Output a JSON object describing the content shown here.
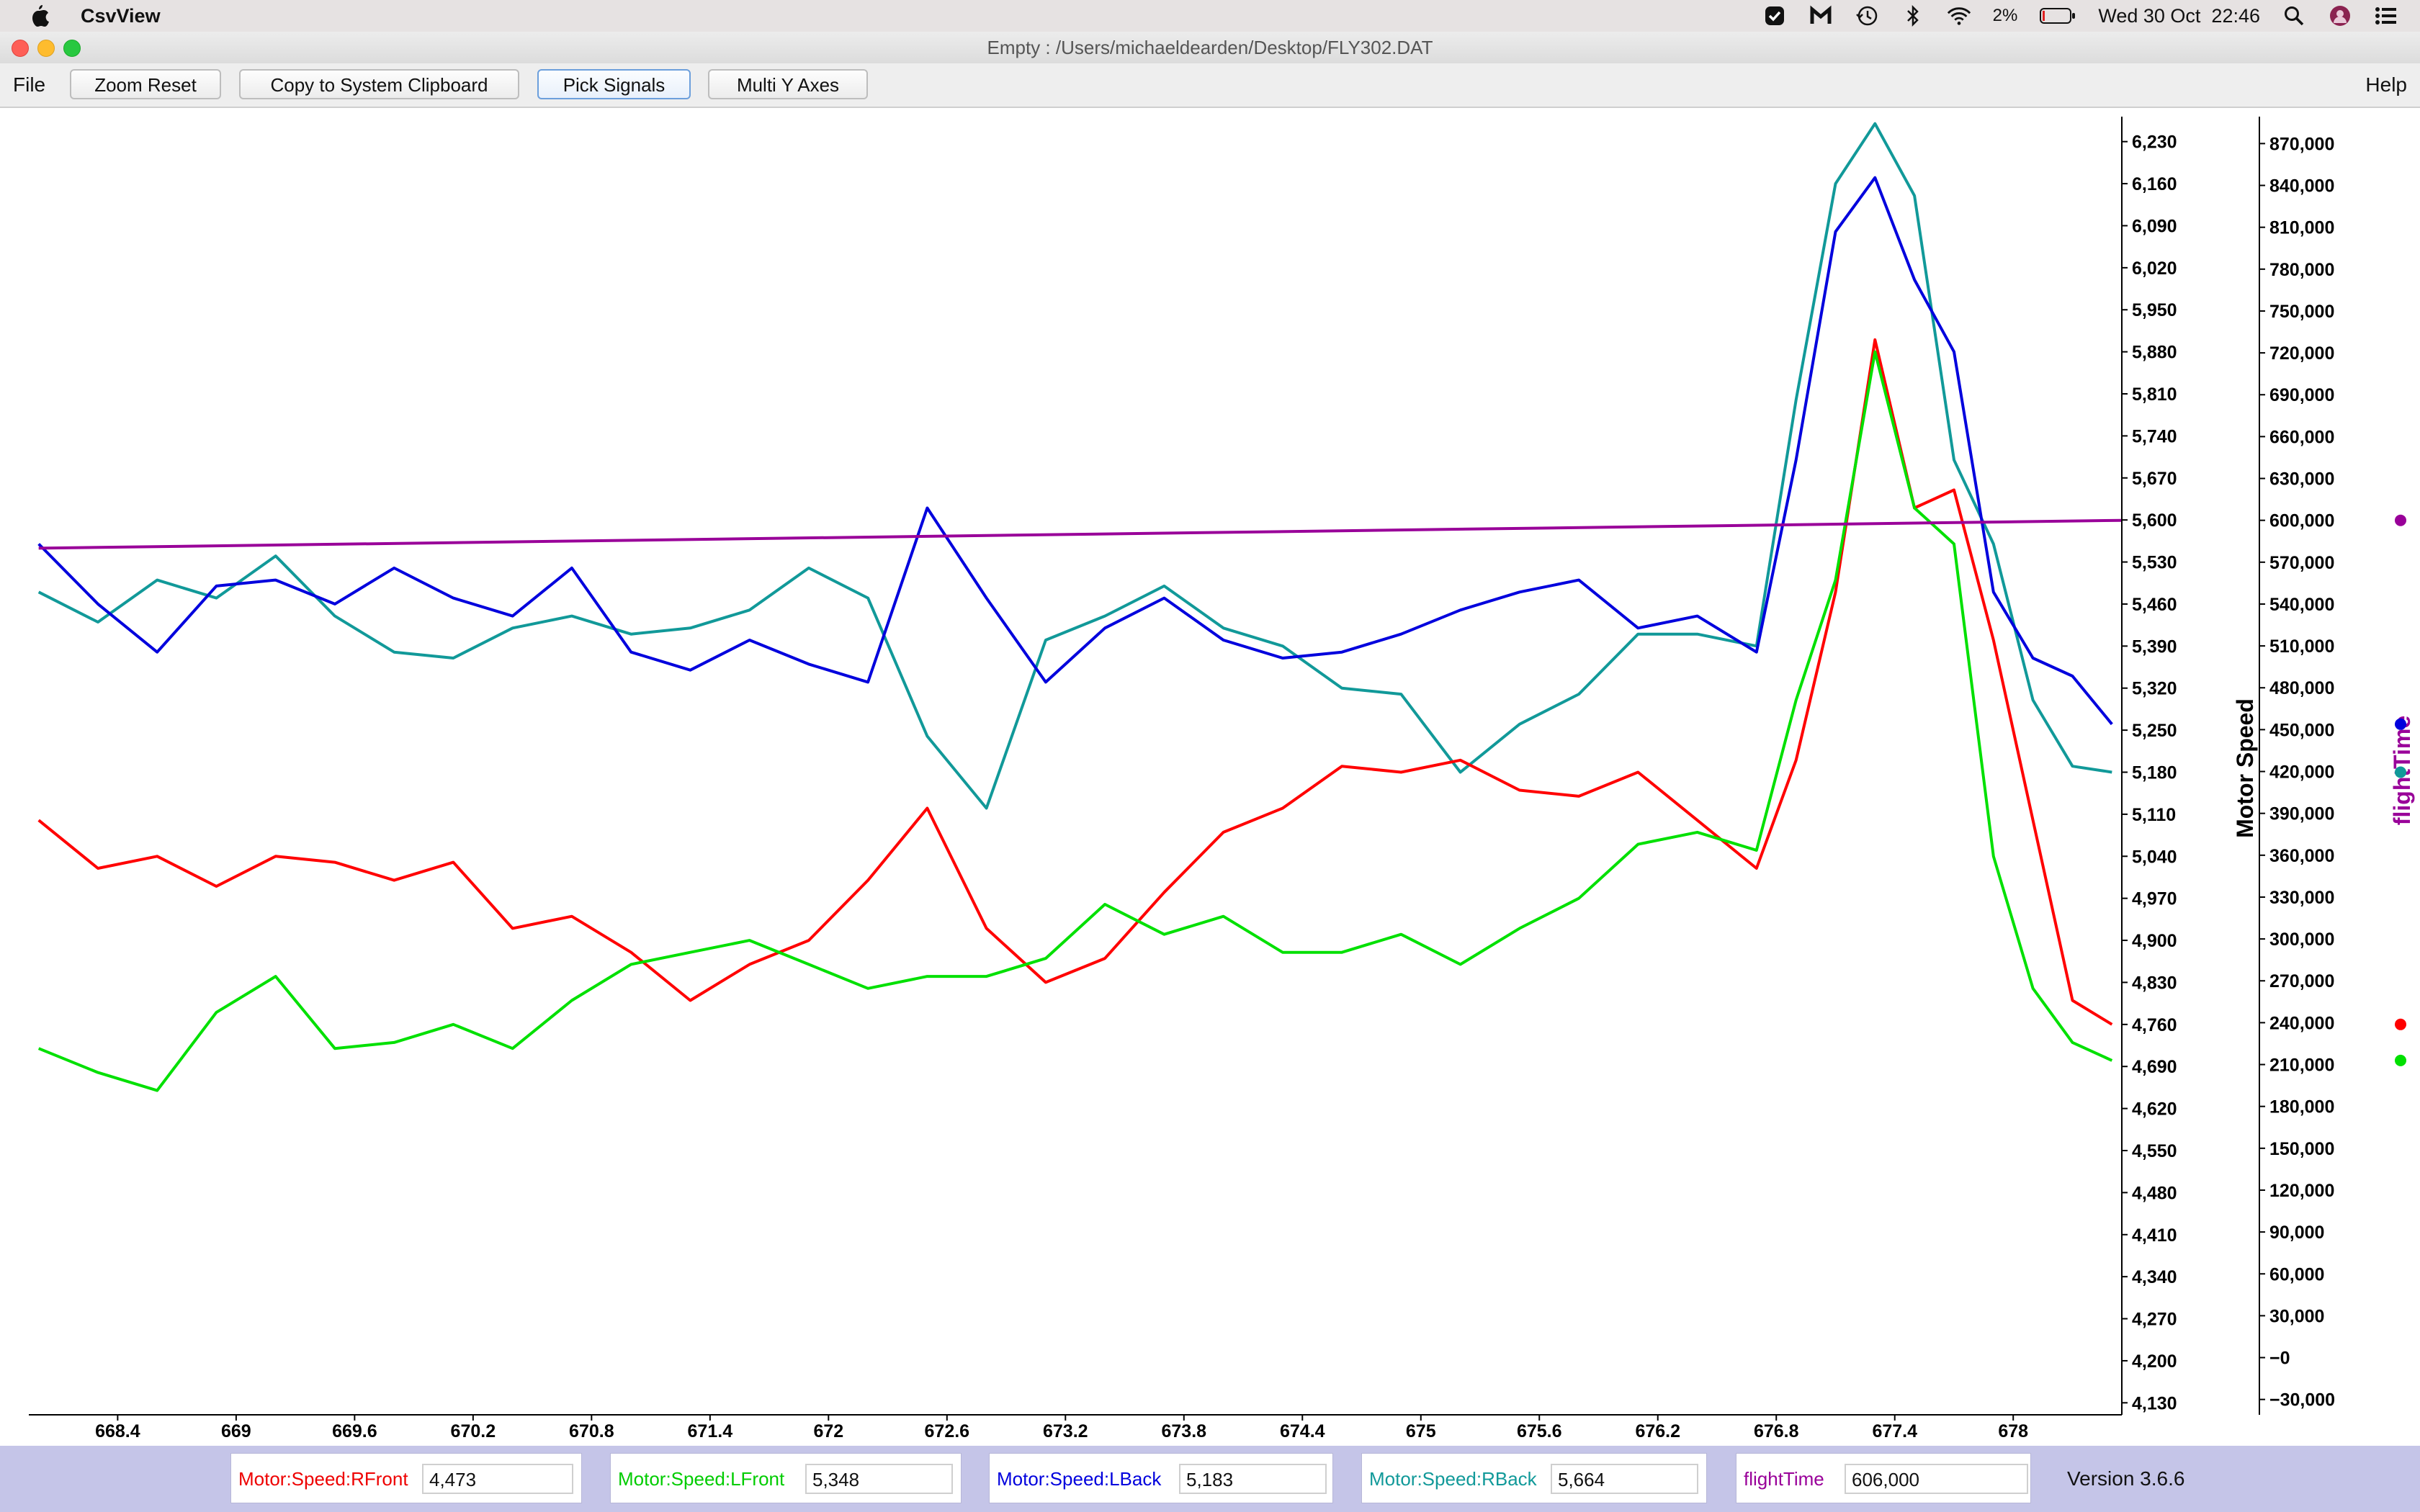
{
  "menubar": {
    "app_name": "CsvView",
    "battery": "2%",
    "clock": "Wed 30 Oct  22:46"
  },
  "window": {
    "title": "Empty : /Users/michaeldearden/Desktop/FLY302.DAT"
  },
  "toolbar": {
    "file_label": "File",
    "help_label": "Help",
    "buttons": [
      {
        "label": "Zoom Reset"
      },
      {
        "label": "Copy to System Clipboard"
      },
      {
        "label": "Pick Signals"
      },
      {
        "label": "Multi Y Axes"
      }
    ]
  },
  "colors": {
    "rfront": "#ff0000",
    "lfront": "#00e000",
    "lback": "#0000dd",
    "rback": "#119999",
    "flighttime": "#990099",
    "statusbar": "#c5c5e8"
  },
  "chart_data": {
    "type": "line",
    "xlim": [
      667.95,
      678.55
    ],
    "x_ticks": [
      "668.4",
      "669",
      "669.6",
      "670.2",
      "670.8",
      "671.4",
      "672",
      "672.6",
      "673.2",
      "673.8",
      "674.4",
      "675",
      "675.6",
      "676.2",
      "676.8",
      "677.4",
      "678"
    ],
    "y1": {
      "label": "Motor Speed",
      "ylim": [
        4110,
        6250
      ],
      "ticks": [
        "6,230",
        "6,160",
        "6,090",
        "6,020",
        "5,950",
        "5,880",
        "5,810",
        "5,740",
        "5,670",
        "5,600",
        "5,530",
        "5,460",
        "5,390",
        "5,320",
        "5,250",
        "5,180",
        "5,110",
        "5,040",
        "4,970",
        "4,900",
        "4,830",
        "4,760",
        "4,690",
        "4,620",
        "4,550",
        "4,480",
        "4,410",
        "4,340",
        "4,270",
        "4,200",
        "4,130"
      ]
    },
    "y2": {
      "label": "flightTime",
      "ylim": [
        -41000,
        880000
      ],
      "ticks": [
        "870,000",
        "840,000",
        "810,000",
        "780,000",
        "750,000",
        "720,000",
        "690,000",
        "660,000",
        "630,000",
        "600,000",
        "570,000",
        "540,000",
        "510,000",
        "480,000",
        "450,000",
        "420,000",
        "390,000",
        "360,000",
        "330,000",
        "300,000",
        "270,000",
        "240,000",
        "210,000",
        "180,000",
        "150,000",
        "120,000",
        "90,000",
        "60,000",
        "30,000",
        "−0",
        "−30,000"
      ]
    },
    "series": [
      {
        "name": "Motor:Speed:RFront",
        "axis": "y1",
        "x": [
          668.0,
          668.3,
          668.6,
          668.9,
          669.2,
          669.5,
          669.8,
          670.1,
          670.4,
          670.7,
          671.0,
          671.3,
          671.6,
          671.9,
          672.2,
          672.5,
          672.8,
          673.1,
          673.4,
          673.7,
          674.0,
          674.3,
          674.6,
          674.9,
          675.2,
          675.5,
          675.8,
          676.1,
          676.4,
          676.7,
          676.9,
          677.1,
          677.3,
          677.5,
          677.7,
          677.9,
          678.1,
          678.3,
          678.5
        ],
        "values": [
          5100,
          5020,
          5040,
          4990,
          5040,
          5030,
          5000,
          5030,
          4920,
          4940,
          4880,
          4800,
          4860,
          4900,
          5000,
          5120,
          4920,
          4830,
          4870,
          4980,
          5080,
          5120,
          5190,
          5180,
          5200,
          5150,
          5140,
          5180,
          5100,
          5020,
          5200,
          5480,
          5900,
          5620,
          5650,
          5400,
          5100,
          4800,
          4760
        ]
      },
      {
        "name": "Motor:Speed:LFront",
        "axis": "y1",
        "x": [
          668.0,
          668.3,
          668.6,
          668.9,
          669.2,
          669.5,
          669.8,
          670.1,
          670.4,
          670.7,
          671.0,
          671.3,
          671.6,
          671.9,
          672.2,
          672.5,
          672.8,
          673.1,
          673.4,
          673.7,
          674.0,
          674.3,
          674.6,
          674.9,
          675.2,
          675.5,
          675.8,
          676.1,
          676.4,
          676.7,
          676.9,
          677.1,
          677.3,
          677.5,
          677.7,
          677.9,
          678.1,
          678.3,
          678.5
        ],
        "values": [
          4720,
          4680,
          4650,
          4780,
          4840,
          4720,
          4730,
          4760,
          4720,
          4800,
          4860,
          4880,
          4900,
          4860,
          4820,
          4840,
          4840,
          4870,
          4960,
          4910,
          4940,
          4880,
          4880,
          4910,
          4860,
          4920,
          4970,
          5060,
          5080,
          5050,
          5300,
          5500,
          5880,
          5620,
          5560,
          5040,
          4820,
          4730,
          4700
        ]
      },
      {
        "name": "Motor:Speed:LBack",
        "axis": "y1",
        "x": [
          668.0,
          668.3,
          668.6,
          668.9,
          669.2,
          669.5,
          669.8,
          670.1,
          670.4,
          670.7,
          671.0,
          671.3,
          671.6,
          671.9,
          672.2,
          672.5,
          672.8,
          673.1,
          673.4,
          673.7,
          674.0,
          674.3,
          674.6,
          674.9,
          675.2,
          675.5,
          675.8,
          676.1,
          676.4,
          676.7,
          676.9,
          677.1,
          677.3,
          677.5,
          677.7,
          677.9,
          678.1,
          678.3,
          678.5
        ],
        "values": [
          5560,
          5460,
          5380,
          5490,
          5500,
          5460,
          5520,
          5470,
          5440,
          5520,
          5380,
          5350,
          5400,
          5360,
          5330,
          5620,
          5470,
          5330,
          5420,
          5470,
          5400,
          5370,
          5380,
          5410,
          5450,
          5480,
          5500,
          5420,
          5440,
          5380,
          5700,
          6080,
          6170,
          6000,
          5880,
          5480,
          5370,
          5340,
          5260
        ]
      },
      {
        "name": "Motor:Speed:RBack",
        "axis": "y1",
        "x": [
          668.0,
          668.3,
          668.6,
          668.9,
          669.2,
          669.5,
          669.8,
          670.1,
          670.4,
          670.7,
          671.0,
          671.3,
          671.6,
          671.9,
          672.2,
          672.5,
          672.8,
          673.1,
          673.4,
          673.7,
          674.0,
          674.3,
          674.6,
          674.9,
          675.2,
          675.5,
          675.8,
          676.1,
          676.4,
          676.7,
          676.9,
          677.1,
          677.3,
          677.5,
          677.7,
          677.9,
          678.1,
          678.3,
          678.5
        ],
        "values": [
          5480,
          5430,
          5500,
          5470,
          5540,
          5440,
          5380,
          5370,
          5420,
          5440,
          5410,
          5420,
          5450,
          5520,
          5470,
          5240,
          5120,
          5400,
          5440,
          5490,
          5420,
          5390,
          5320,
          5310,
          5180,
          5260,
          5310,
          5410,
          5410,
          5390,
          5800,
          6160,
          6260,
          6140,
          5700,
          5560,
          5300,
          5190,
          5180
        ]
      },
      {
        "name": "flightTime",
        "axis": "y2",
        "x": [
          668.0,
          678.55
        ],
        "values": [
          580000,
          600000
        ]
      }
    ]
  },
  "status": {
    "signals": [
      {
        "name": "Motor:Speed:RFront",
        "value": "4,473",
        "color": "#ee0000"
      },
      {
        "name": "Motor:Speed:LFront",
        "value": "5,348",
        "color": "#00cc00"
      },
      {
        "name": "Motor:Speed:LBack",
        "value": "5,183",
        "color": "#0000dd"
      },
      {
        "name": "Motor:Speed:RBack",
        "value": "5,664",
        "color": "#119999"
      },
      {
        "name": "flightTime",
        "value": "606,000",
        "color": "#990099"
      }
    ],
    "version": "Version 3.6.6"
  }
}
